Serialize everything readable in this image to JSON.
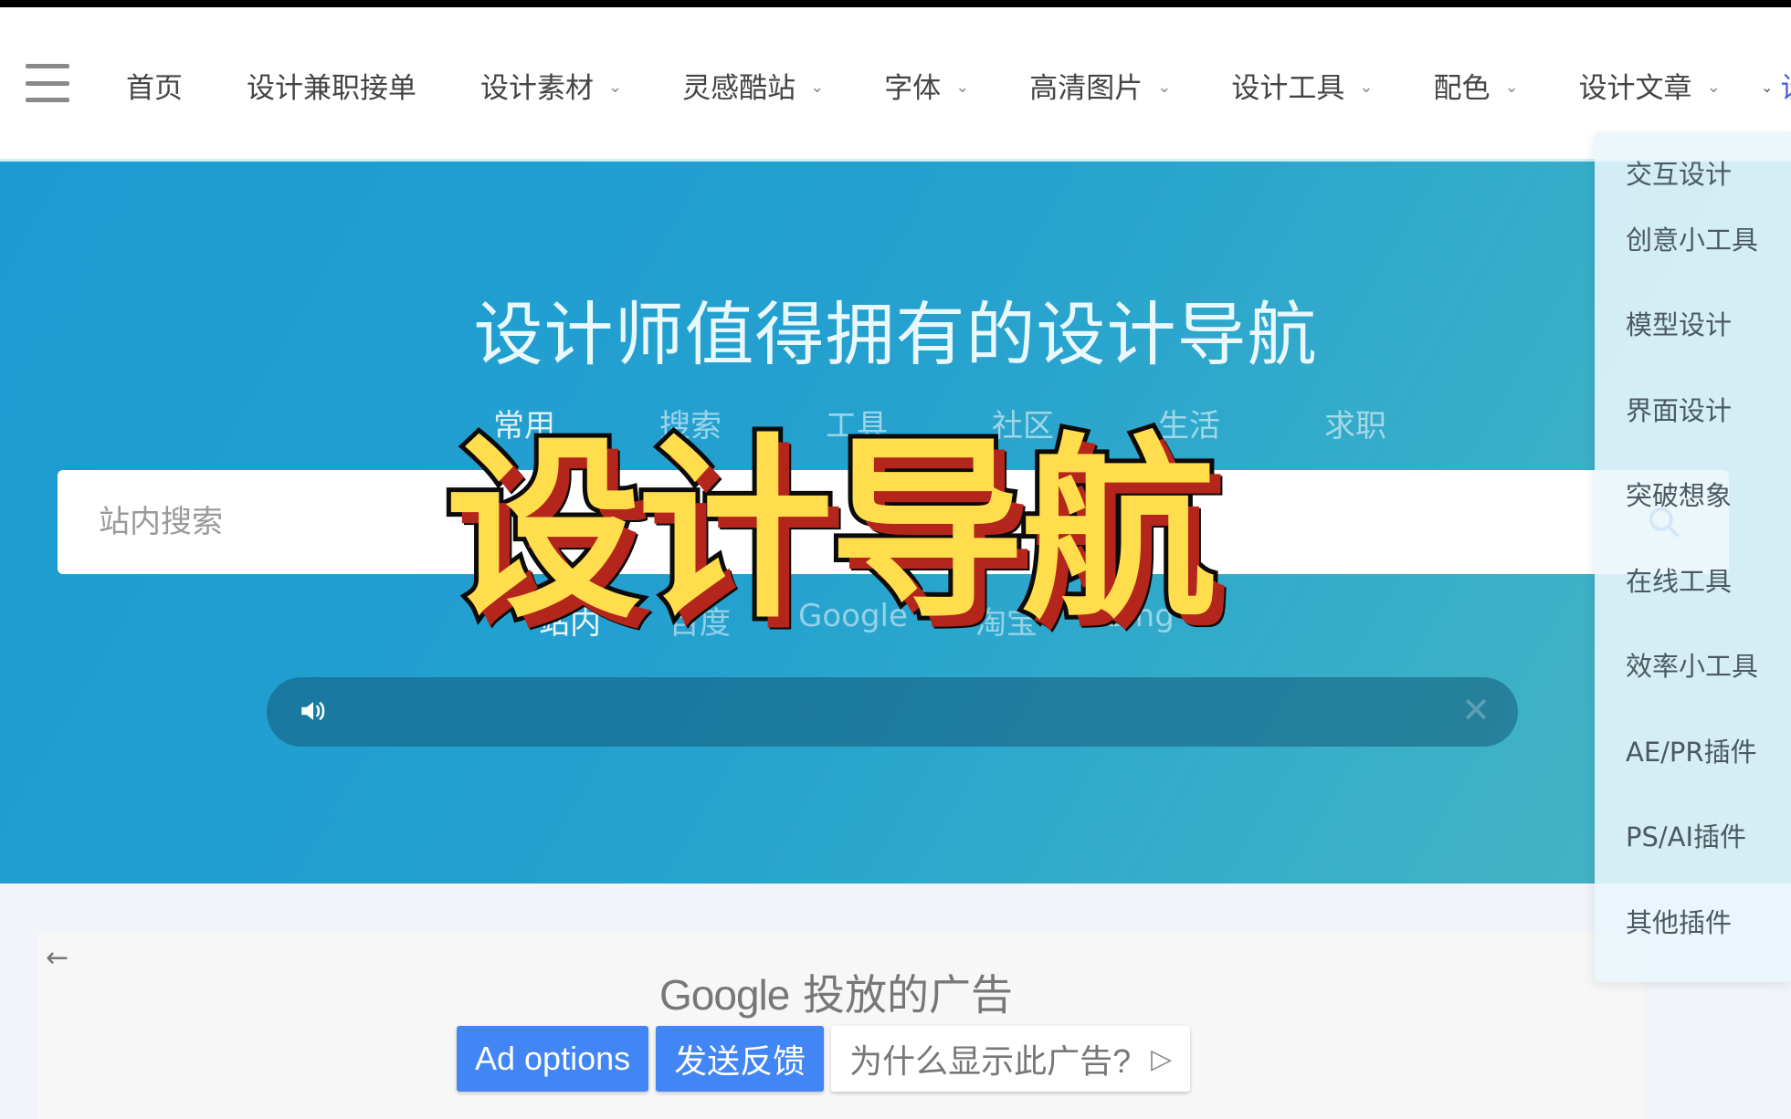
{
  "nav": {
    "menu_icon": "hamburger-icon",
    "items": [
      {
        "label": "首页",
        "has_dropdown": false
      },
      {
        "label": "设计兼职接单",
        "has_dropdown": false
      },
      {
        "label": "设计素材",
        "has_dropdown": true
      },
      {
        "label": "灵感酷站",
        "has_dropdown": true
      },
      {
        "label": "字体",
        "has_dropdown": true
      },
      {
        "label": "高清图片",
        "has_dropdown": true
      },
      {
        "label": "设计工具",
        "has_dropdown": true
      },
      {
        "label": "配色",
        "has_dropdown": true
      },
      {
        "label": "设计文章",
        "has_dropdown": true
      },
      {
        "label": "设计软件",
        "has_dropdown": true,
        "active": true
      }
    ],
    "chevron_glyph": "⌄",
    "active_color": "#4a5bd6"
  },
  "dropdown": {
    "items": [
      "交互设计",
      "创意小工具",
      "模型设计",
      "界面设计",
      "突破想象",
      "在线工具",
      "效率小工具",
      "AE/PR插件",
      "PS/AI插件",
      "其他插件"
    ]
  },
  "hero": {
    "title": "设计师值得拥有的设计导航",
    "tabs": [
      "常用",
      "搜索",
      "工具",
      "社区",
      "生活",
      "求职"
    ],
    "active_tab": "常用",
    "search": {
      "placeholder": "站内搜索",
      "value": ""
    },
    "engines": [
      "站内",
      "百度",
      "Google",
      "淘宝",
      "Bing"
    ],
    "active_engine": "站内",
    "notice": {
      "text": "",
      "close_glyph": "✕"
    }
  },
  "overlay": {
    "title": "设计导航"
  },
  "ad": {
    "back_glyph": "←",
    "heading_brand": "Google",
    "heading_text": "投放的广告",
    "buttons": {
      "ad_options": "Ad options",
      "feedback": "发送反馈",
      "why": "为什么显示此广告?"
    },
    "accent": "#4285f4"
  },
  "colors": {
    "hero_start": "#1c9bd1",
    "hero_end": "#49b5c4",
    "overlay_fill": "#ffdd4d",
    "overlay_shadow": "#b4261b"
  }
}
